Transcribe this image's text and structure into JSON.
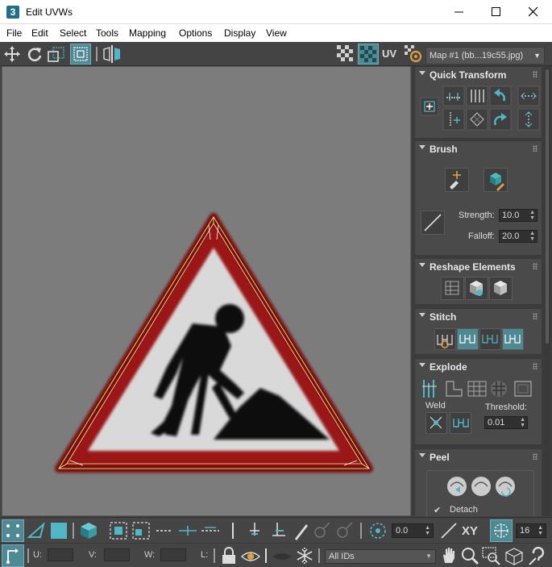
{
  "window": {
    "title": "Edit UVWs",
    "app_icon": "3"
  },
  "menu": [
    "File",
    "Edit",
    "Select",
    "Tools",
    "Mapping",
    "Options",
    "Display",
    "View"
  ],
  "toolbar": {
    "map_dropdown": "Map #1 (bb...19c55.jpg)",
    "uv_label": "UV"
  },
  "panel": {
    "quick_transform": {
      "title": "Quick Transform"
    },
    "brush": {
      "title": "Brush",
      "strength_label": "Strength:",
      "strength_value": "10.0",
      "falloff_label": "Falloff:",
      "falloff_value": "20.0"
    },
    "reshape": {
      "title": "Reshape Elements"
    },
    "stitch": {
      "title": "Stitch"
    },
    "explode": {
      "title": "Explode",
      "weld_label": "Weld",
      "threshold_label": "Threshold:",
      "threshold_value": "0.01"
    },
    "peel": {
      "title": "Peel",
      "detach_label": "Detach",
      "detach_checked": true
    }
  },
  "bottom": {
    "angle_value": "0.0",
    "xy_label": "XY",
    "snap_value": "16",
    "u_label": "U:",
    "v_label": "V:",
    "w_label": "W:",
    "l_label": "L:",
    "ids_dropdown": "All IDs"
  },
  "colors": {
    "accent": "#4fb8c4",
    "background": "#444444",
    "viewport": "#7c7c7c",
    "sign_red": "#a01515"
  }
}
